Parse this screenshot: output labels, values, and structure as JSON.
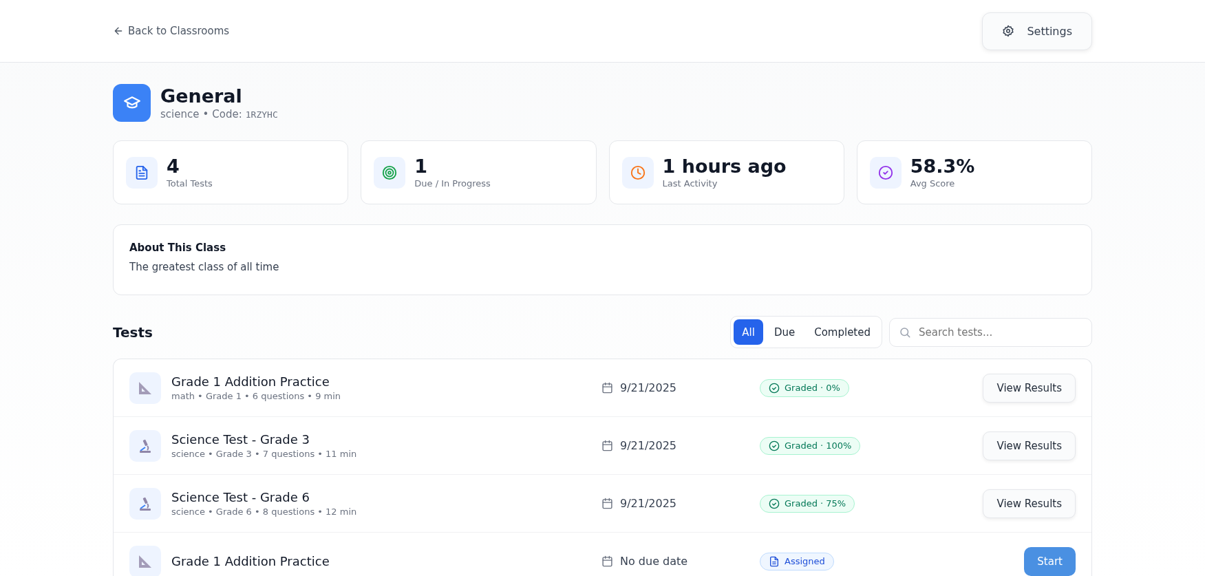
{
  "header": {
    "back_link": "Back to Classrooms",
    "settings_button": "Settings"
  },
  "class": {
    "name": "General",
    "subject": "science",
    "separator": "•",
    "code_label": "Code:",
    "code": "1RZYHC"
  },
  "stats": [
    {
      "kind": "tests",
      "value": "4",
      "label": "Total Tests"
    },
    {
      "kind": "due",
      "value": "1",
      "label": "Due / In Progress"
    },
    {
      "kind": "activity",
      "value": "1 hours ago",
      "label": "Last Activity"
    },
    {
      "kind": "score",
      "value": "58.3%",
      "label": "Avg Score"
    }
  ],
  "about": {
    "title": "About This Class",
    "text": "The greatest class of all time"
  },
  "tests_section": {
    "title": "Tests",
    "filters": [
      {
        "label": "All",
        "selected": true
      },
      {
        "label": "Due",
        "selected": false
      },
      {
        "label": "Completed",
        "selected": false
      }
    ],
    "search": {
      "placeholder": "Search tests..."
    }
  },
  "tests": [
    {
      "icon": {
        "kind": "ruler"
      },
      "title": "Grade 1 Addition Practice",
      "meta": "math • Grade 1 • 6 questions • 9 min",
      "date": "9/21/2025",
      "status": {
        "kind": "graded",
        "label": "Graded · 0%"
      },
      "action": {
        "kind": "view",
        "label": "View Results"
      }
    },
    {
      "icon": {
        "kind": "microscope"
      },
      "title": "Science Test - Grade 3",
      "meta": "science • Grade 3 • 7 questions • 11 min",
      "date": "9/21/2025",
      "status": {
        "kind": "graded",
        "label": "Graded · 100%"
      },
      "action": {
        "kind": "view",
        "label": "View Results"
      }
    },
    {
      "icon": {
        "kind": "microscope"
      },
      "title": "Science Test - Grade 6",
      "meta": "science • Grade 6 • 8 questions • 12 min",
      "date": "9/21/2025",
      "status": {
        "kind": "graded",
        "label": "Graded · 75%"
      },
      "action": {
        "kind": "view",
        "label": "View Results"
      }
    },
    {
      "icon": {
        "kind": "ruler"
      },
      "title": "Grade 1 Addition Practice",
      "date": "No due date",
      "status": {
        "kind": "assigned",
        "label": "Assigned"
      },
      "action": {
        "kind": "start",
        "label": "Start"
      }
    }
  ]
}
